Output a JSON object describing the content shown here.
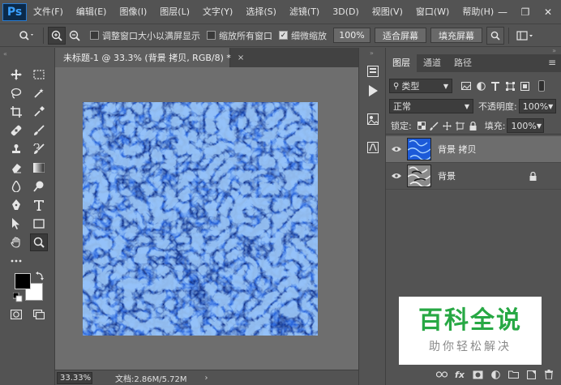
{
  "app": {
    "logo": "Ps",
    "menu": [
      "文件(F)",
      "编辑(E)",
      "图像(I)",
      "图层(L)",
      "文字(Y)",
      "选择(S)",
      "滤镜(T)",
      "3D(D)",
      "视图(V)",
      "窗口(W)",
      "帮助(H)"
    ],
    "window_controls": {
      "minimize": "—",
      "restore": "❐",
      "close": "✕"
    }
  },
  "options": {
    "resize_window_label": "调整窗口大小以满屏显示",
    "zoom_all_label": "缩放所有窗口",
    "scrubby_zoom_label": "细微缩放",
    "zoom_value": "100%",
    "fit_screen_label": "适合屏幕",
    "fill_screen_label": "填充屏幕"
  },
  "document": {
    "tab_title": "未标题-1 @ 33.3% (背景 拷贝, RGB/8) *",
    "close": "×",
    "zoom": "33.33%",
    "doc_info": "文档:2.86M/5.72M",
    "status_arrow": "›"
  },
  "layers_panel": {
    "tabs": [
      "图层",
      "通道",
      "路径"
    ],
    "menu_icon": "≡",
    "filter_kind": "类型",
    "blend_mode": "正常",
    "opacity_label": "不透明度:",
    "opacity_value": "100%",
    "lock_label": "锁定:",
    "fill_label": "填充:",
    "fill_value": "100%",
    "layers": [
      {
        "name": "背景 拷贝",
        "selected": true,
        "locked": false
      },
      {
        "name": "背景",
        "selected": false,
        "locked": true
      }
    ],
    "footer_fx": "fx"
  },
  "watermark": {
    "title": "百科全说",
    "subtitle": "助你轻松解决"
  },
  "colors": {
    "canvas_bg": "#6e6e6e",
    "ui_bg": "#535353",
    "accent_blue": "#1c5ad8",
    "watermark_green": "#27a844"
  }
}
